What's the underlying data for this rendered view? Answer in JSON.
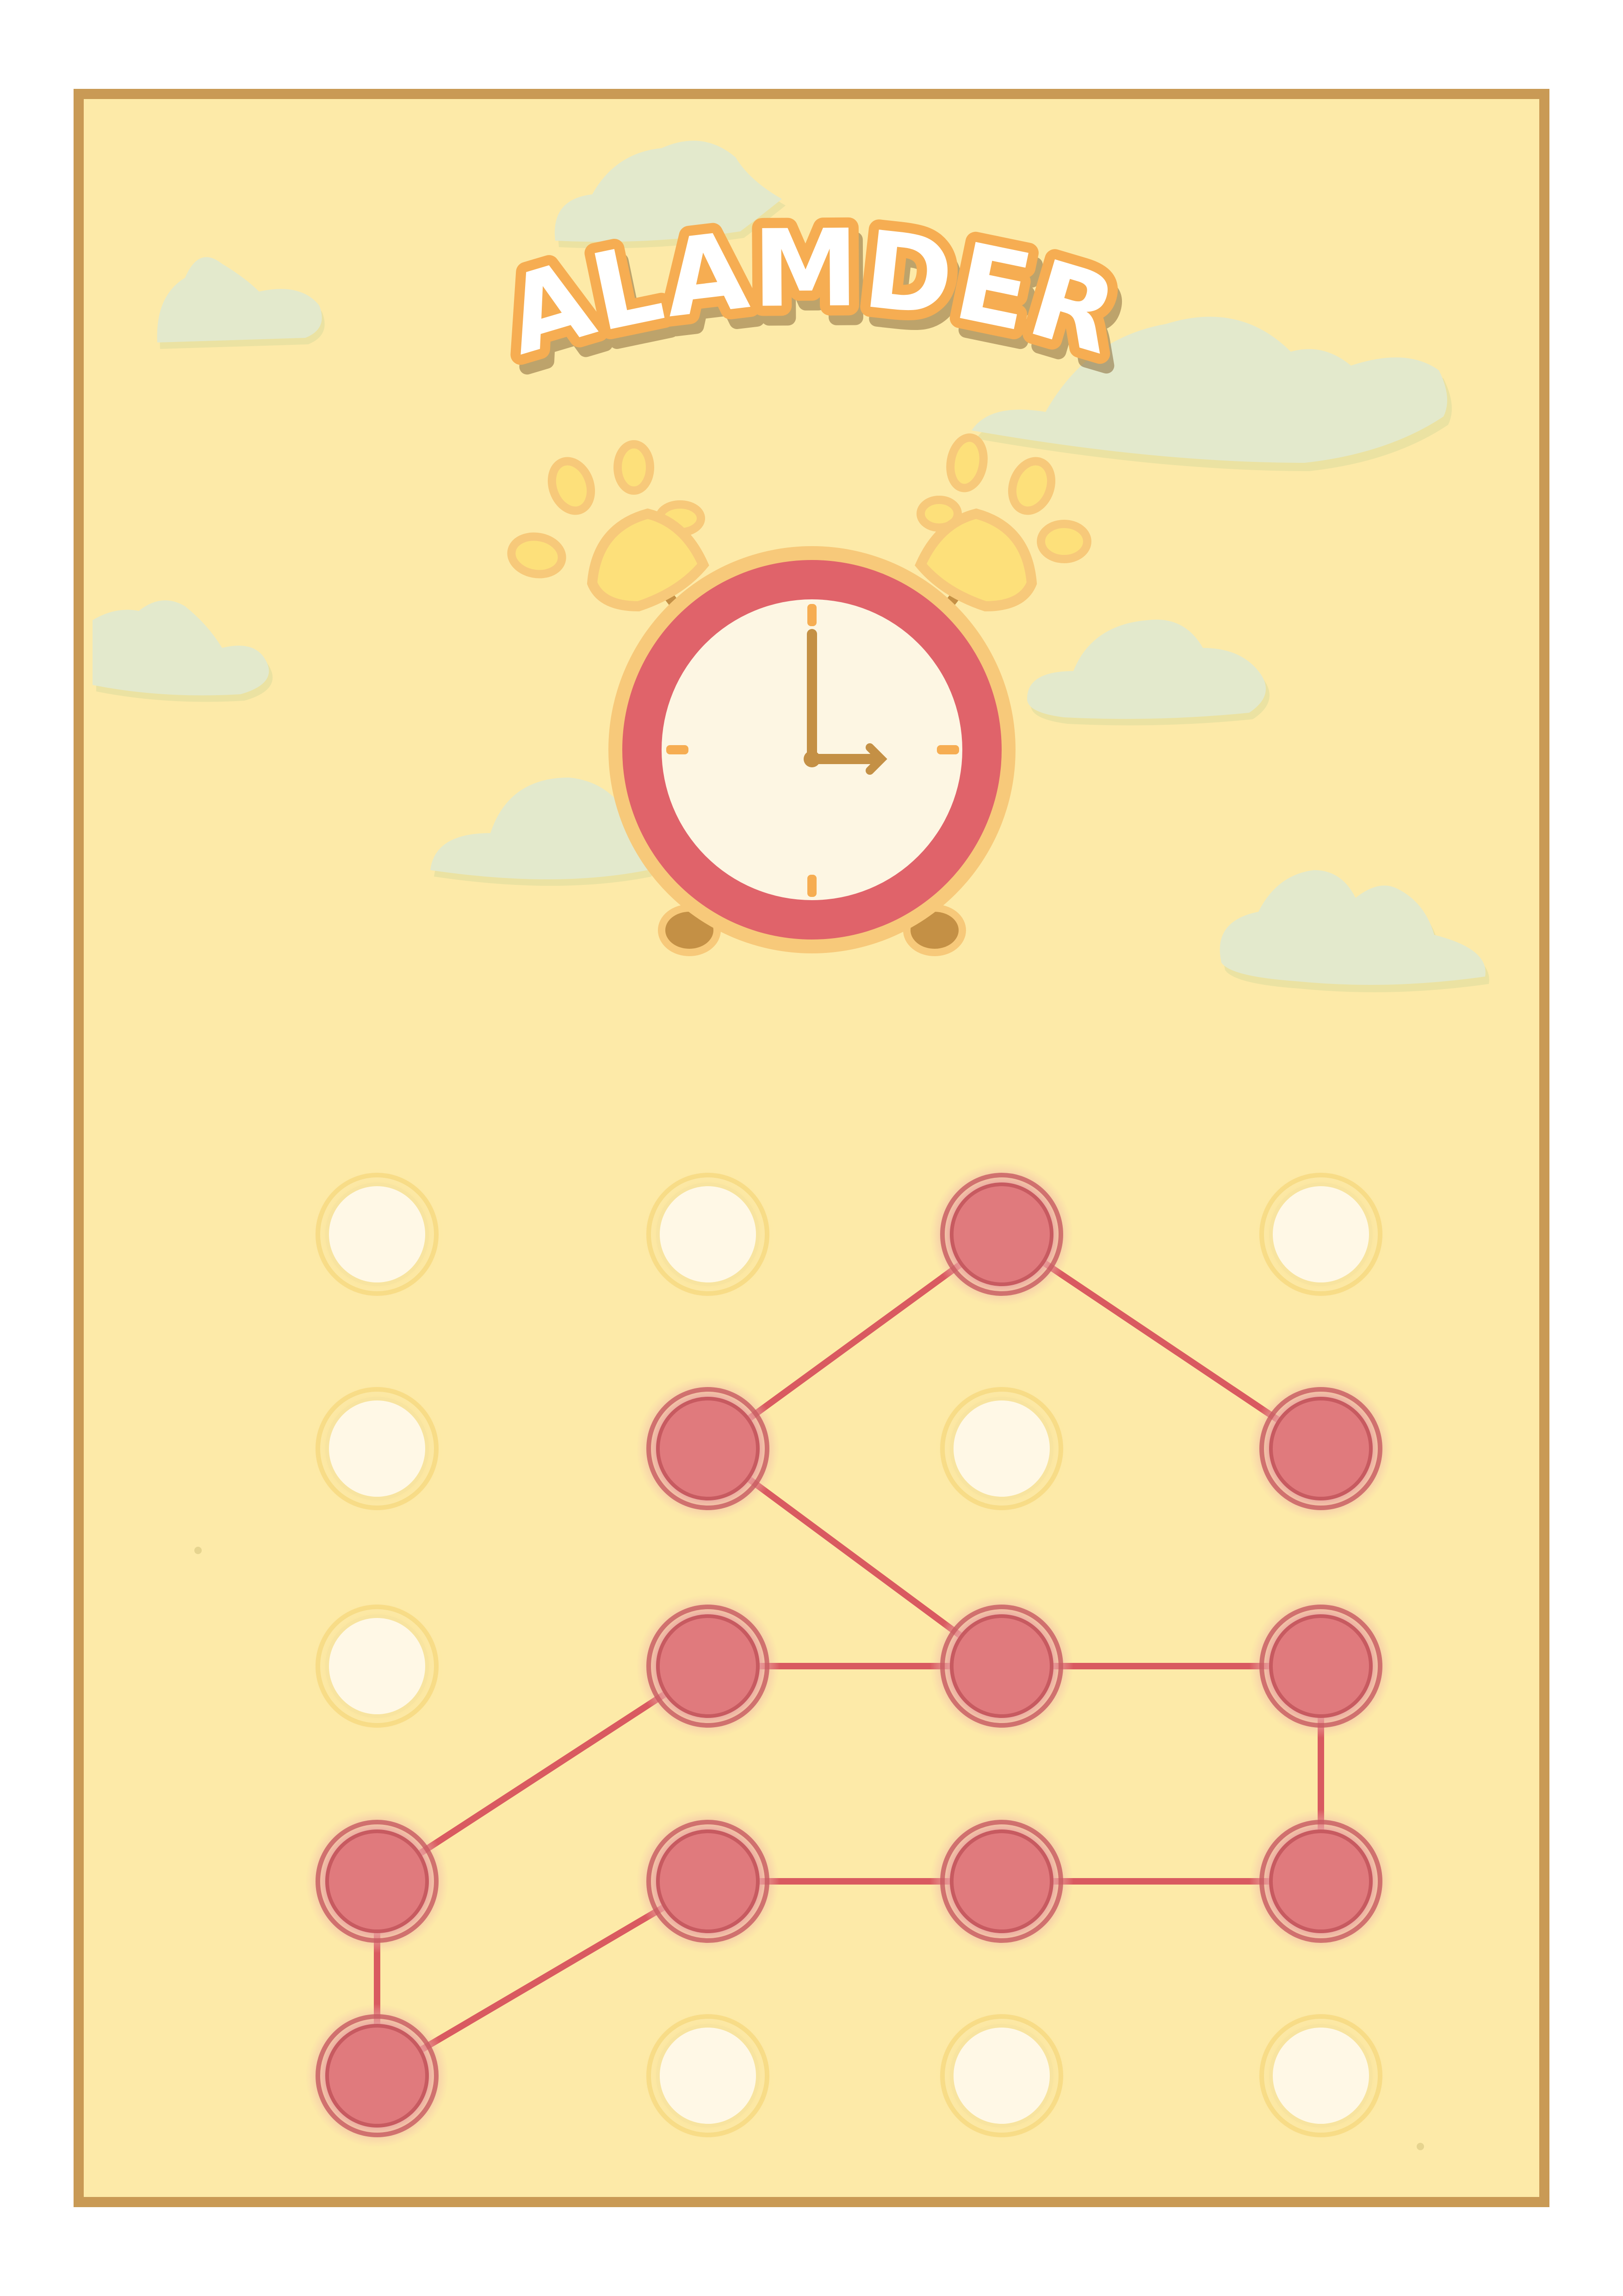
{
  "app": {
    "title": "ALAMDER"
  },
  "colors": {
    "page_background": "#ffffff",
    "frame_border": "#c99a55",
    "panel_background": "#fdeaa8",
    "cloud": "#e3e9cc",
    "cloud_shadow": "#ebe2a2",
    "title_fill": "#ffffff",
    "title_outline": "#f6ad52",
    "clock_rim": "#e0636a",
    "clock_face": "#fdf6e3",
    "clock_hands": "#c49045",
    "bell": "#fde07a",
    "bell_outline": "#f7c97a",
    "dot_active": "#e07a7d",
    "dot_active_ring": "#c75a60",
    "dot_inactive": "#fff8e6",
    "dot_inactive_ring": "#f5d67a",
    "pattern_line": "#d95a60"
  },
  "clock": {
    "hour": 3,
    "minute": 0
  },
  "pattern_lock": {
    "rows": 5,
    "columns": 4,
    "active_dots": [
      [
        0,
        2
      ],
      [
        1,
        1
      ],
      [
        1,
        3
      ],
      [
        2,
        1
      ],
      [
        2,
        2
      ],
      [
        2,
        3
      ],
      [
        3,
        0
      ],
      [
        3,
        1
      ],
      [
        3,
        2
      ],
      [
        3,
        3
      ],
      [
        4,
        0
      ]
    ],
    "path": [
      [
        4,
        0
      ],
      [
        3,
        0
      ],
      [
        2,
        1
      ],
      [
        2,
        2
      ],
      [
        1,
        1
      ],
      [
        0,
        2
      ],
      [
        1,
        3
      ]
    ],
    "path_secondary": [
      [
        4,
        0
      ],
      [
        3,
        1
      ],
      [
        3,
        2
      ],
      [
        3,
        3
      ],
      [
        2,
        3
      ],
      [
        2,
        2
      ]
    ],
    "path_extra": [
      [
        2,
        1
      ],
      [
        2,
        2
      ]
    ]
  }
}
